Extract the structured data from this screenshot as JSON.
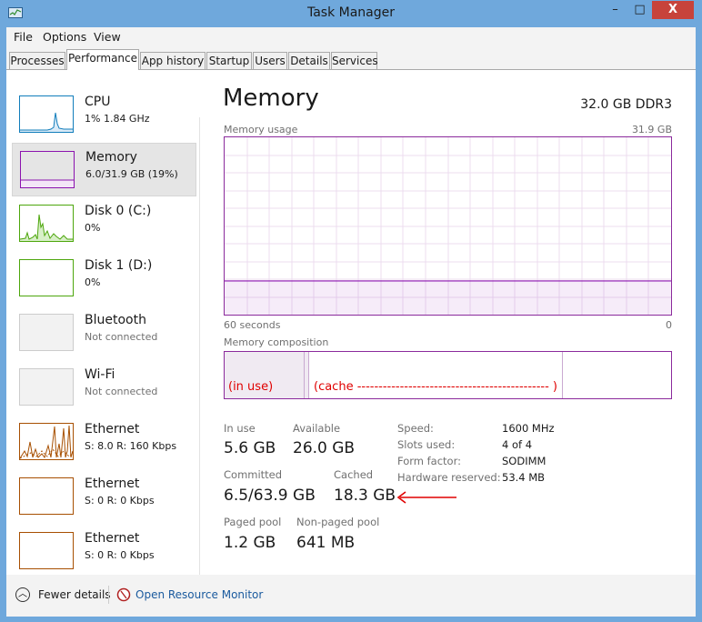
{
  "window": {
    "title": "Task Manager",
    "controls": {
      "minimize": "–",
      "maximize": "□",
      "close": "X"
    }
  },
  "menu": [
    "File",
    "Options",
    "View"
  ],
  "tabs": [
    {
      "label": "Processes"
    },
    {
      "label": "Performance",
      "active": true
    },
    {
      "label": "App history"
    },
    {
      "label": "Startup"
    },
    {
      "label": "Users"
    },
    {
      "label": "Details"
    },
    {
      "label": "Services"
    }
  ],
  "sidebar": [
    {
      "name": "CPU",
      "sub": "1% 1.84 GHz",
      "color": "#117dbb"
    },
    {
      "name": "Memory",
      "sub": "6.0/31.9 GB (19%)",
      "color": "#8b12ae",
      "active": true
    },
    {
      "name": "Disk 0 (C:)",
      "sub": "0%",
      "color": "#4da60c"
    },
    {
      "name": "Disk 1 (D:)",
      "sub": "0%",
      "color": "#4da60c"
    },
    {
      "name": "Bluetooth",
      "sub": "Not connected",
      "color": "#cccccc"
    },
    {
      "name": "Wi-Fi",
      "sub": "Not connected",
      "color": "#cccccc"
    },
    {
      "name": "Ethernet",
      "sub": "S: 8.0  R: 160 Kbps",
      "color": "#a74f01"
    },
    {
      "name": "Ethernet",
      "sub": "S: 0  R: 0 Kbps",
      "color": "#a74f01"
    },
    {
      "name": "Ethernet",
      "sub": "S: 0  R: 0 Kbps",
      "color": "#a74f01"
    }
  ],
  "main": {
    "heading": "Memory",
    "total": "32.0 GB DDR3",
    "usage_label": "Memory usage",
    "usage_max": "31.9 GB",
    "time_left": "60 seconds",
    "time_right": "0",
    "usage_fraction": 0.19,
    "composition_label": "Memory composition",
    "annotations": {
      "in_use": "(in use)",
      "cache": "(cache  --------------------------------------------- )"
    },
    "stats": {
      "in_use": {
        "label": "In use",
        "value": "5.6 GB"
      },
      "available": {
        "label": "Available",
        "value": "26.0 GB"
      },
      "committed": {
        "label": "Committed",
        "value": "6.5/63.9 GB"
      },
      "cached": {
        "label": "Cached",
        "value": "18.3 GB"
      },
      "paged": {
        "label": "Paged pool",
        "value": "1.2 GB"
      },
      "nonpaged": {
        "label": "Non-paged pool",
        "value": "641 MB"
      }
    },
    "details": [
      {
        "label": "Speed:",
        "value": "1600 MHz"
      },
      {
        "label": "Slots used:",
        "value": "4 of 4"
      },
      {
        "label": "Form factor:",
        "value": "SODIMM"
      },
      {
        "label": "Hardware reserved:",
        "value": "53.4 MB"
      }
    ]
  },
  "footer": {
    "fewer": "Fewer details",
    "resource_monitor": "Open Resource Monitor"
  },
  "colors": {
    "memory": "#8b12ae",
    "annotation": "#e00000",
    "link": "#1a5a9e"
  }
}
